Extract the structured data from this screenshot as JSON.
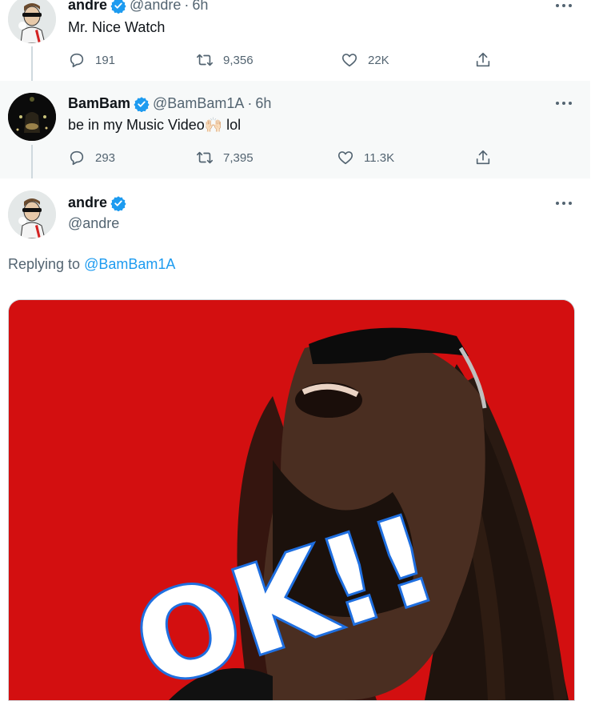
{
  "tweets": [
    {
      "name": "andre",
      "handle": "@andre",
      "time": "6h",
      "text": "Mr. Nice Watch",
      "replies": "191",
      "retweets": "9,356",
      "likes": "22K"
    },
    {
      "name": "BamBam",
      "handle": "@BamBam1A",
      "time": "6h",
      "text_before": "be in my Music Video",
      "emoji": "🙌🏻",
      "text_after": " lol",
      "replies": "293",
      "retweets": "7,395",
      "likes": "11.3K"
    }
  ],
  "main_tweet": {
    "name": "andre",
    "handle": "@andre",
    "replying_prefix": "Replying to ",
    "replying_to": "@BamBam1A",
    "media_caption": "OK!!"
  },
  "icons": {
    "verified": "verified-badge-icon",
    "reply": "reply-icon",
    "retweet": "retweet-icon",
    "like": "heart-icon",
    "share": "share-icon",
    "more": "more-dots-icon"
  },
  "colors": {
    "accent": "#1d9bf0",
    "muted": "#536471",
    "media_background": "#d00f0f",
    "caption_fill": "#ffffff",
    "caption_stroke": "#1f6fe0"
  }
}
